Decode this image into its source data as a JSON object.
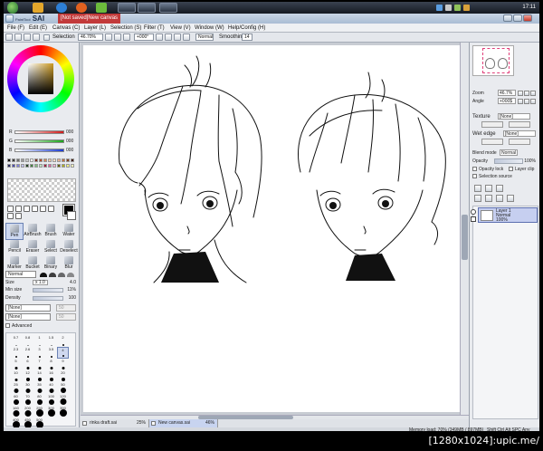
{
  "taskbar": {
    "clock": "17:11",
    "tasks": [
      "",
      "",
      "",
      "",
      "",
      ""
    ]
  },
  "titlebar": {
    "app_name": "SAI",
    "app_prefix": "PaintTool",
    "doc_name": "[Not saved]New canvas"
  },
  "menu": [
    "File (F)",
    "Edit (E)",
    "Canvas (C)",
    "Layer (L)",
    "Selection (S)",
    "Filter (T)",
    "View (V)",
    "Window (W)",
    "Help/Config (H)"
  ],
  "toolbar": {
    "selection_label": "Selection",
    "zoom": "46.70%",
    "rotation": "+000°",
    "mode": "Normal",
    "smoothing_label": "Smoothing",
    "smoothing_value": "14"
  },
  "color": {
    "sliders": [
      {
        "label": "R",
        "value": "000",
        "color": "#d11a1a"
      },
      {
        "label": "G",
        "value": "000",
        "color": "#1aa61a"
      },
      {
        "label": "B",
        "value": "000",
        "color": "#1a3bd1"
      }
    ]
  },
  "tools": [
    {
      "label": "Pen",
      "selected": true
    },
    {
      "label": "AirBrush",
      "selected": false
    },
    {
      "label": "Brush",
      "selected": false
    },
    {
      "label": "Water",
      "selected": false
    },
    {
      "label": "Pencil",
      "selected": false
    },
    {
      "label": "Eraser",
      "selected": false
    },
    {
      "label": "Select",
      "selected": false
    },
    {
      "label": "Deselect",
      "selected": false
    },
    {
      "label": "Marker",
      "selected": false
    },
    {
      "label": "Bucket",
      "selected": false
    },
    {
      "label": "Binary",
      "selected": false
    },
    {
      "label": "Blur",
      "selected": false
    }
  ],
  "brush": {
    "mode": "Normal",
    "size_label": "Size",
    "size_mult": "x 1.0",
    "size_value": "4.0",
    "minsize_label": "Min size",
    "minsize_value": "11%",
    "density_label": "Density",
    "density_value": "100",
    "shape1": "[None]",
    "shape1_val": "50",
    "shape2": "[None]",
    "shape2_val": "50",
    "advanced": "Advanced",
    "sizes": [
      "0.7",
      "0.8",
      "1",
      "1.5",
      "2",
      "2.3",
      "2.6",
      "3",
      "3.5",
      "4",
      "5",
      "6",
      "7",
      "8",
      "9",
      "10",
      "12",
      "14",
      "16",
      "20",
      "25",
      "30",
      "35",
      "40",
      "50",
      "60",
      "70",
      "80",
      "100",
      "120",
      "160",
      "200",
      "250",
      "300",
      "350",
      "400",
      "450",
      "500"
    ]
  },
  "documents": [
    {
      "name": "rinka draft.sai",
      "zoom": "25%",
      "active": false
    },
    {
      "name": "New canvas.sai",
      "zoom": "46%",
      "active": true
    }
  ],
  "right": {
    "zoom_label": "Zoom",
    "zoom_value": "46.7%",
    "angle_label": "Angle",
    "angle_value": "+000$",
    "texture_label": "Texture",
    "texture_value": "[None]",
    "wetedge_label": "Wet edge",
    "wetedge_value": "[None]",
    "blend_label": "Blend mode",
    "blend_value": "Normal",
    "opacity_label": "Opacity",
    "opacity_value": "100%",
    "opacity_lock": "Opacity lock",
    "layer_clip": "Layer clip",
    "selection_source": "Selection source",
    "layer": {
      "name": "Layer 1",
      "mode": "Normal",
      "opacity": "100%"
    }
  },
  "status": {
    "memory": "Memory load: 70% (349MB / 897MB)",
    "keys": "Shift Ctrl Alt SPC Any"
  },
  "watermark": "[1280x1024]:upic.me/"
}
